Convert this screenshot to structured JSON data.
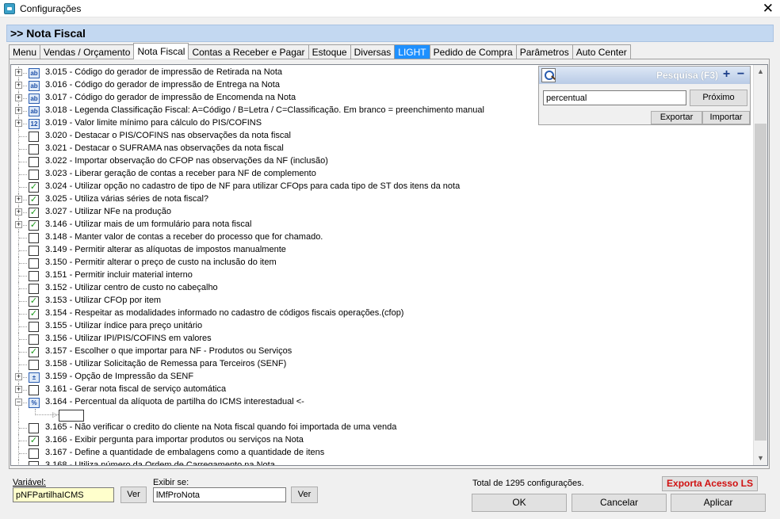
{
  "window": {
    "title": "Configurações",
    "close_glyph": "✕"
  },
  "header": {
    "title": ">> Nota Fiscal"
  },
  "tabs": [
    {
      "label": "Menu",
      "active": false,
      "highlight": false
    },
    {
      "label": "Vendas / Orçamento",
      "active": false,
      "highlight": false
    },
    {
      "label": "Nota Fiscal",
      "active": true,
      "highlight": false
    },
    {
      "label": "Contas a Receber e Pagar",
      "active": false,
      "highlight": false
    },
    {
      "label": "Estoque",
      "active": false,
      "highlight": false
    },
    {
      "label": "Diversas",
      "active": false,
      "highlight": false
    },
    {
      "label": "LIGHT",
      "active": false,
      "highlight": true
    },
    {
      "label": "Pedido de Compra",
      "active": false,
      "highlight": false
    },
    {
      "label": "Parâmetros",
      "active": false,
      "highlight": false
    },
    {
      "label": "Auto Center",
      "active": false,
      "highlight": false
    }
  ],
  "tree": {
    "items": [
      {
        "label": "3.015 - Código do gerador de impressão de Retirada na Nota",
        "expander": "+",
        "kind": "text",
        "checked": false
      },
      {
        "label": "3.016 - Código do gerador de impressão de Entrega na Nota",
        "expander": "+",
        "kind": "text",
        "checked": false
      },
      {
        "label": "3.017 - Código do gerador de impressão de Encomenda na Nota",
        "expander": "+",
        "kind": "text",
        "checked": false
      },
      {
        "label": "3.018 - Legenda Classificação Fiscal: A=Código / B=Letra / C=Classificação. Em branco = preenchimento manual",
        "expander": "+",
        "kind": "text",
        "checked": false
      },
      {
        "label": "3.019 - Valor limite mínimo para cálculo do PIS/COFINS",
        "expander": "+",
        "kind": "number",
        "checked": false
      },
      {
        "label": "3.020 - Destacar o PIS/COFINS nas observações da nota fiscal",
        "expander": "",
        "kind": "check",
        "checked": false
      },
      {
        "label": "3.021 - Destacar o SUFRAMA nas observações da nota fiscal",
        "expander": "",
        "kind": "check",
        "checked": false
      },
      {
        "label": "3.022 - Importar observação do CFOP nas observações da NF (inclusão)",
        "expander": "",
        "kind": "check",
        "checked": false
      },
      {
        "label": "3.023 - Liberar geração de contas a receber para NF de complemento",
        "expander": "",
        "kind": "check",
        "checked": false
      },
      {
        "label": "3.024 - Utilizar opção no cadastro de tipo de NF para utilizar CFOps para cada tipo de ST dos itens da nota",
        "expander": "",
        "kind": "check",
        "checked": true
      },
      {
        "label": "3.025 - Utiliza várias séries de nota fiscal?",
        "expander": "+",
        "kind": "check",
        "checked": true
      },
      {
        "label": "3.027 - Utilizar NFe na produção",
        "expander": "+",
        "kind": "check",
        "checked": true
      },
      {
        "label": "3.146 - Utilizar mais de um formulário para nota fiscal",
        "expander": "+",
        "kind": "check",
        "checked": true
      },
      {
        "label": "3.148 - Manter valor de contas a receber do processo que for chamado.",
        "expander": "",
        "kind": "check",
        "checked": false
      },
      {
        "label": "3.149 - Permitir alterar as alíquotas de impostos manualmente",
        "expander": "",
        "kind": "check",
        "checked": false
      },
      {
        "label": "3.150 - Permitir alterar o preço de custo na inclusão do item",
        "expander": "",
        "kind": "check",
        "checked": false
      },
      {
        "label": "3.151 - Permitir incluir material interno",
        "expander": "",
        "kind": "check",
        "checked": false
      },
      {
        "label": "3.152 - Utilizar centro de custo no cabeçalho",
        "expander": "",
        "kind": "check",
        "checked": false
      },
      {
        "label": "3.153 - Utilizar CFOp por item",
        "expander": "",
        "kind": "check",
        "checked": true
      },
      {
        "label": "3.154 - Respeitar as modalidades informado no cadastro de códigos fiscais operações.(cfop)",
        "expander": "",
        "kind": "check",
        "checked": true
      },
      {
        "label": "3.155 - Utilizar índice para preço unitário",
        "expander": "",
        "kind": "check",
        "checked": false
      },
      {
        "label": "3.156 - Utilizar IPI/PIS/COFINS em valores",
        "expander": "",
        "kind": "check",
        "checked": false
      },
      {
        "label": "3.157 - Escolher o que importar para NF - Produtos ou Serviços",
        "expander": "",
        "kind": "check",
        "checked": true
      },
      {
        "label": "3.158 - Utilizar Solicitação de Remessa para Terceiros (SENF)",
        "expander": "",
        "kind": "check",
        "checked": false
      },
      {
        "label": "3.159 - Opção de Impressão da SENF",
        "expander": "+",
        "kind": "option",
        "checked": false
      },
      {
        "label": "3.161 - Gerar nota fiscal de serviço automática",
        "expander": "+",
        "kind": "check",
        "checked": false
      },
      {
        "label": "3.164 - Percentual da alíquota de partilha do ICMS interestadual <-",
        "expander": "−",
        "kind": "percent",
        "checked": false
      },
      {
        "label": "",
        "expander": "",
        "kind": "edit",
        "checked": false
      },
      {
        "label": "3.165 - Não verificar o credito do cliente na Nota fiscal quando foi importada de uma venda",
        "expander": "",
        "kind": "check",
        "checked": false
      },
      {
        "label": "3.166 - Exibir pergunta para importar produtos ou serviços na Nota",
        "expander": "",
        "kind": "check",
        "checked": true
      },
      {
        "label": "3.167 - Define a quantidade de embalagens como a quantidade de itens",
        "expander": "",
        "kind": "check",
        "checked": false
      },
      {
        "label": "3.168 - Utiliza número da Ordem de Carregamento na Nota",
        "expander": "",
        "kind": "check",
        "checked": false
      }
    ],
    "type_icons": {
      "text": "ab",
      "number": "12",
      "option": "±",
      "percent": "%"
    },
    "check_glyph": "✓"
  },
  "scrollbar": {
    "up": "▲",
    "down": "▼"
  },
  "search": {
    "title": "Pesquisa (F3)",
    "plus": "+",
    "minus": "−",
    "value": "percentual",
    "next_label": "Próximo",
    "export_label": "Exportar",
    "import_label": "Importar"
  },
  "footer": {
    "variable_label": "Variável:",
    "variable_value": "pNFPartilhaICMS",
    "ver_label": "Ver",
    "show_if_label": "Exibir se:",
    "show_if_value": "lMfProNota",
    "total_text": "Total de 1295 configurações.",
    "export_access_label": "Exporta Acesso LS",
    "ok_label": "OK",
    "cancel_label": "Cancelar",
    "apply_label": "Aplicar"
  },
  "colors": {
    "header_band": "#c3d8f1",
    "light_tab": "#1e90ff",
    "variable_field": "#ffffcc",
    "check_green": "#1a9a1a",
    "export_access_text": "#d01010"
  }
}
